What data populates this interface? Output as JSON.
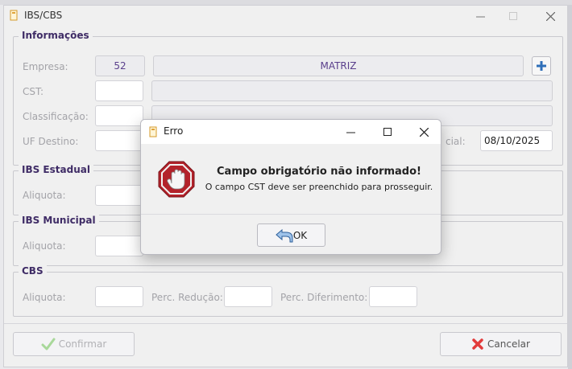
{
  "window": {
    "title": "IBS/CBS"
  },
  "informacoes": {
    "title": "Informações",
    "empresa_label": "Empresa:",
    "empresa_code": "52",
    "empresa_name": "MATRIZ",
    "cst_label": "CST:",
    "classificacao_label": "Classificação:",
    "uf_destino_label": "UF Destino:",
    "inicial_label": "cial:",
    "inicial_date": "08/10/2025"
  },
  "ibs_estadual": {
    "title": "IBS Estadual",
    "aliquota_label": "Aliquota:"
  },
  "ibs_municipal": {
    "title": "IBS Municipal",
    "aliquota_label": "Aliquota:"
  },
  "cbs": {
    "title": "CBS",
    "aliquota_label": "Aliquota:",
    "perc_reducao_label": "Perc. Redução:",
    "perc_diferimento_label": "Perc. Diferimento:"
  },
  "footer": {
    "confirmar_label": "Confirmar",
    "cancelar_label": "Cancelar"
  },
  "dialog": {
    "title": "Erro",
    "heading": "Campo obrigatório não informado!",
    "message": "O campo CST deve ser preenchido para prosseguir.",
    "ok_label": "OK"
  },
  "colors": {
    "accent": "#3f2c66",
    "confirm_green": "#6cc04a",
    "cancel_red": "#e23b3b",
    "stop_red": "#b3222a"
  },
  "icons": [
    "app-icon",
    "plus-icon",
    "check-icon",
    "x-icon",
    "stop-hand-icon",
    "back-arrow-icon"
  ]
}
